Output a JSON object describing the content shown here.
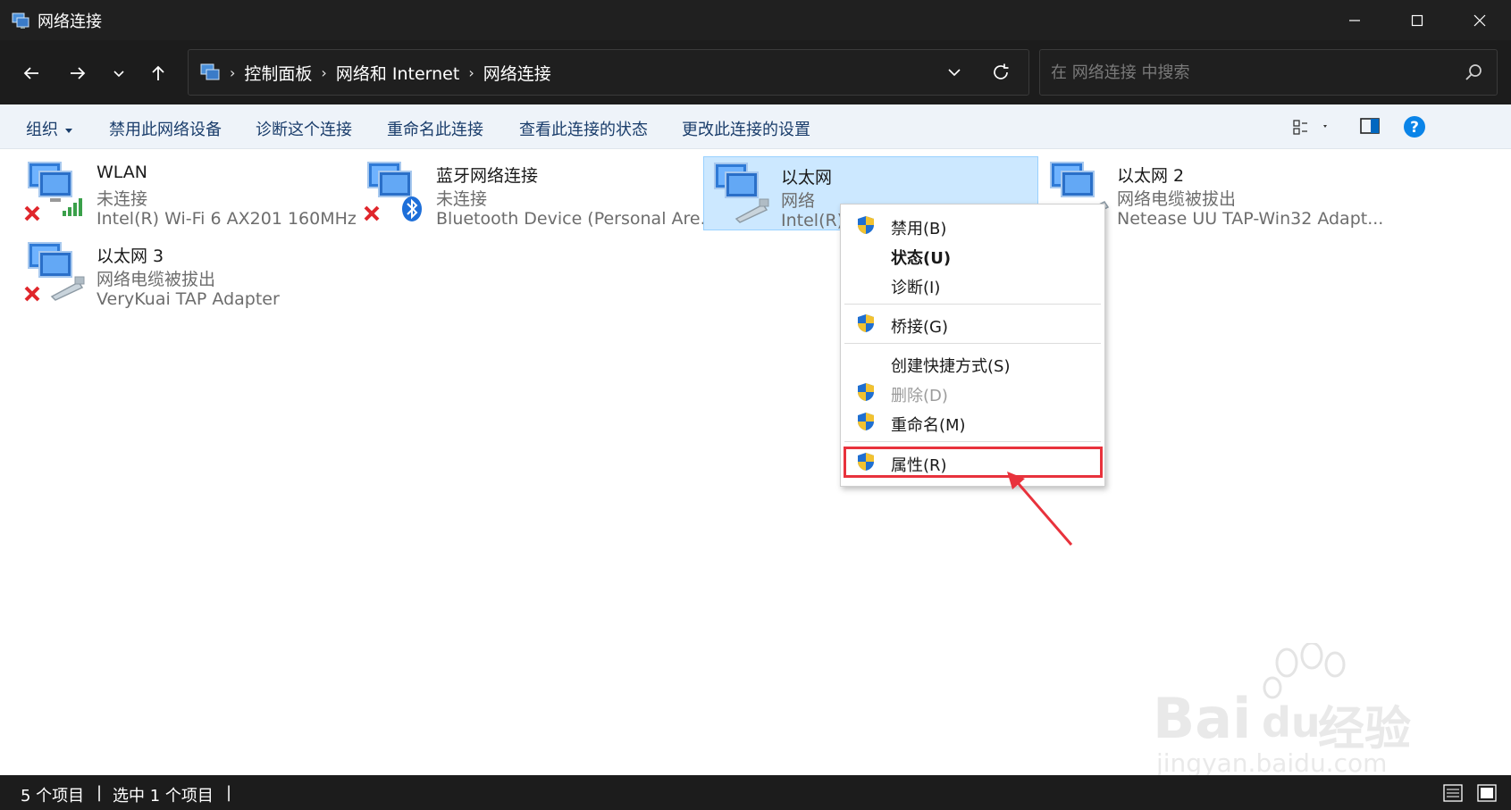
{
  "window": {
    "title": "网络连接"
  },
  "nav": {
    "breadcrumbs": [
      "控制面板",
      "网络和 Internet",
      "网络连接"
    ],
    "search_placeholder": "在 网络连接 中搜索"
  },
  "commands": {
    "organize": "组织",
    "disable_device": "禁用此网络设备",
    "diagnose": "诊断这个连接",
    "rename": "重命名此连接",
    "view_status": "查看此连接的状态",
    "change_settings": "更改此连接的设置"
  },
  "connections": [
    {
      "name": "WLAN",
      "status": "未连接",
      "device": "Intel(R) Wi-Fi 6 AX201 160MHz",
      "icon": "wifi-network-icon",
      "error": true
    },
    {
      "name": "蓝牙网络连接",
      "status": "未连接",
      "device": "Bluetooth Device (Personal Are...",
      "icon": "bluetooth-network-icon",
      "error": true
    },
    {
      "name": "以太网",
      "status": "网络",
      "device": "Intel(R)",
      "icon": "ethernet-network-icon",
      "error": false,
      "selected": true
    },
    {
      "name": "以太网 2",
      "status": "网络电缆被拔出",
      "device": "Netease UU TAP-Win32 Adapt...",
      "icon": "ethernet-network-icon",
      "error": false
    },
    {
      "name": "以太网 3",
      "status": "网络电缆被拔出",
      "device": "VeryKuai TAP Adapter",
      "icon": "ethernet-network-icon",
      "error": true
    }
  ],
  "context_menu": {
    "items": [
      {
        "label": "禁用(B)",
        "shield": true
      },
      {
        "label": "状态(U)",
        "bold": true
      },
      {
        "label": "诊断(I)"
      },
      {
        "label": "桥接(G)",
        "shield": true
      },
      {
        "label": "创建快捷方式(S)"
      },
      {
        "label": "删除(D)",
        "shield": true,
        "disabled": true
      },
      {
        "label": "重命名(M)",
        "shield": true
      },
      {
        "label": "属性(R)",
        "shield": true,
        "highlighted": true
      }
    ]
  },
  "statusbar": {
    "item_count": "5 个项目",
    "selected_count": "选中 1 个项目"
  },
  "watermark": {
    "brand": "Bai",
    "brand_tail": "du",
    "brand_cn": "经验",
    "url": "jingyan.baidu.com"
  },
  "colors": {
    "titlebar": "#202020",
    "selected_bg": "#cce8ff",
    "highlight_red": "#e8323c",
    "accent_blue": "#0067c0"
  }
}
